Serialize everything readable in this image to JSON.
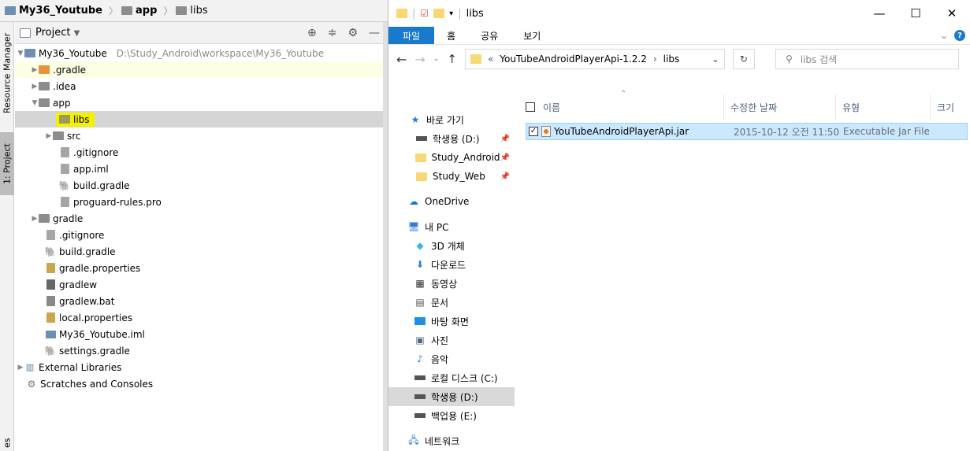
{
  "breadcrumb": {
    "project": "My36_Youtube",
    "module": "app",
    "folder": "libs"
  },
  "sidebar_tabs": {
    "resource_manager": "Resource Manager",
    "project": "1: Project",
    "bottom": "es"
  },
  "project_panel": {
    "title": "Project"
  },
  "tree": {
    "root_name": "My36_Youtube",
    "root_path": "D:\\Study_Android\\workspace\\My36_Youtube",
    "items": {
      "gradle_dir": ".gradle",
      "idea": ".idea",
      "app": "app",
      "libs": "libs",
      "src": "src",
      "app_gitignore": ".gitignore",
      "app_iml": "app.iml",
      "app_build_gradle": "build.gradle",
      "proguard": "proguard-rules.pro",
      "gradle": "gradle",
      "gitignore": ".gitignore",
      "build_gradle": "build.gradle",
      "gradle_properties": "gradle.properties",
      "gradlew": "gradlew",
      "gradlew_bat": "gradlew.bat",
      "local_properties": "local.properties",
      "iml": "My36_Youtube.iml",
      "settings_gradle": "settings.gradle",
      "external_libraries": "External Libraries",
      "scratches": "Scratches and Consoles"
    }
  },
  "explorer": {
    "title": "libs",
    "ribbon": {
      "file": "파일",
      "home": "홈",
      "share": "공유",
      "view": "보기"
    },
    "address": {
      "prefix": "«",
      "parent": "YouTubeAndroidPlayerApi-1.2.2",
      "current": "libs"
    },
    "search_placeholder": "libs 검색",
    "nav": {
      "quick_access": "바로 가기",
      "student_d_pinned": "학생용 (D:)",
      "study_android": "Study_Android",
      "study_web": "Study_Web",
      "onedrive": "OneDrive",
      "this_pc": "내 PC",
      "objects3d": "3D 개체",
      "downloads": "다운로드",
      "videos": "동영상",
      "documents": "문서",
      "desktop": "바탕 화면",
      "pictures": "사진",
      "music": "음악",
      "local_c": "로컬 디스크 (C:)",
      "student_d": "학생용 (D:)",
      "backup_e": "백업용 (E:)",
      "network": "네트워크"
    },
    "columns": {
      "name": "이름",
      "modified": "수정한 날짜",
      "type": "유형",
      "size": "크기"
    },
    "files": [
      {
        "name": "YouTubeAndroidPlayerApi.jar",
        "modified": "2015-10-12 오전 11:50",
        "type": "Executable Jar File"
      }
    ]
  }
}
